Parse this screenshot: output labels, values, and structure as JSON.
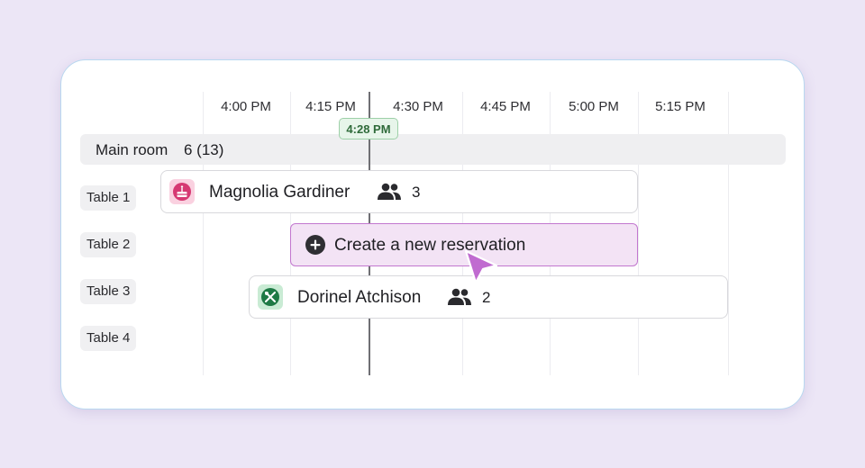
{
  "timeline": {
    "times": [
      "4:00 PM",
      "4:15 PM",
      "4:30 PM",
      "4:45 PM",
      "5:00 PM",
      "5:15 PM"
    ],
    "current_time": "4:28 PM"
  },
  "room": {
    "name": "Main room",
    "count": "6 (13)"
  },
  "tables": [
    {
      "label": "Table 1"
    },
    {
      "label": "Table 2"
    },
    {
      "label": "Table 3"
    },
    {
      "label": "Table 4"
    }
  ],
  "reservations": [
    {
      "name": "Magnolia Gardiner",
      "guests": "3",
      "icon": "birthday-cake-icon",
      "icon_color": "#d63872",
      "icon_bg": "#fad1e0"
    },
    {
      "name": "Dorinel Atchison",
      "guests": "2",
      "icon": "utensils-icon",
      "icon_color": "#1e7a45",
      "icon_bg": "#c9ebd4"
    }
  ],
  "create": {
    "label": "Create a new reservation",
    "accent": "#c277cf"
  },
  "colors": {
    "background": "#ece6f6",
    "now_badge_bg": "#e7f5ea",
    "now_badge_text": "#2f6b3a"
  }
}
